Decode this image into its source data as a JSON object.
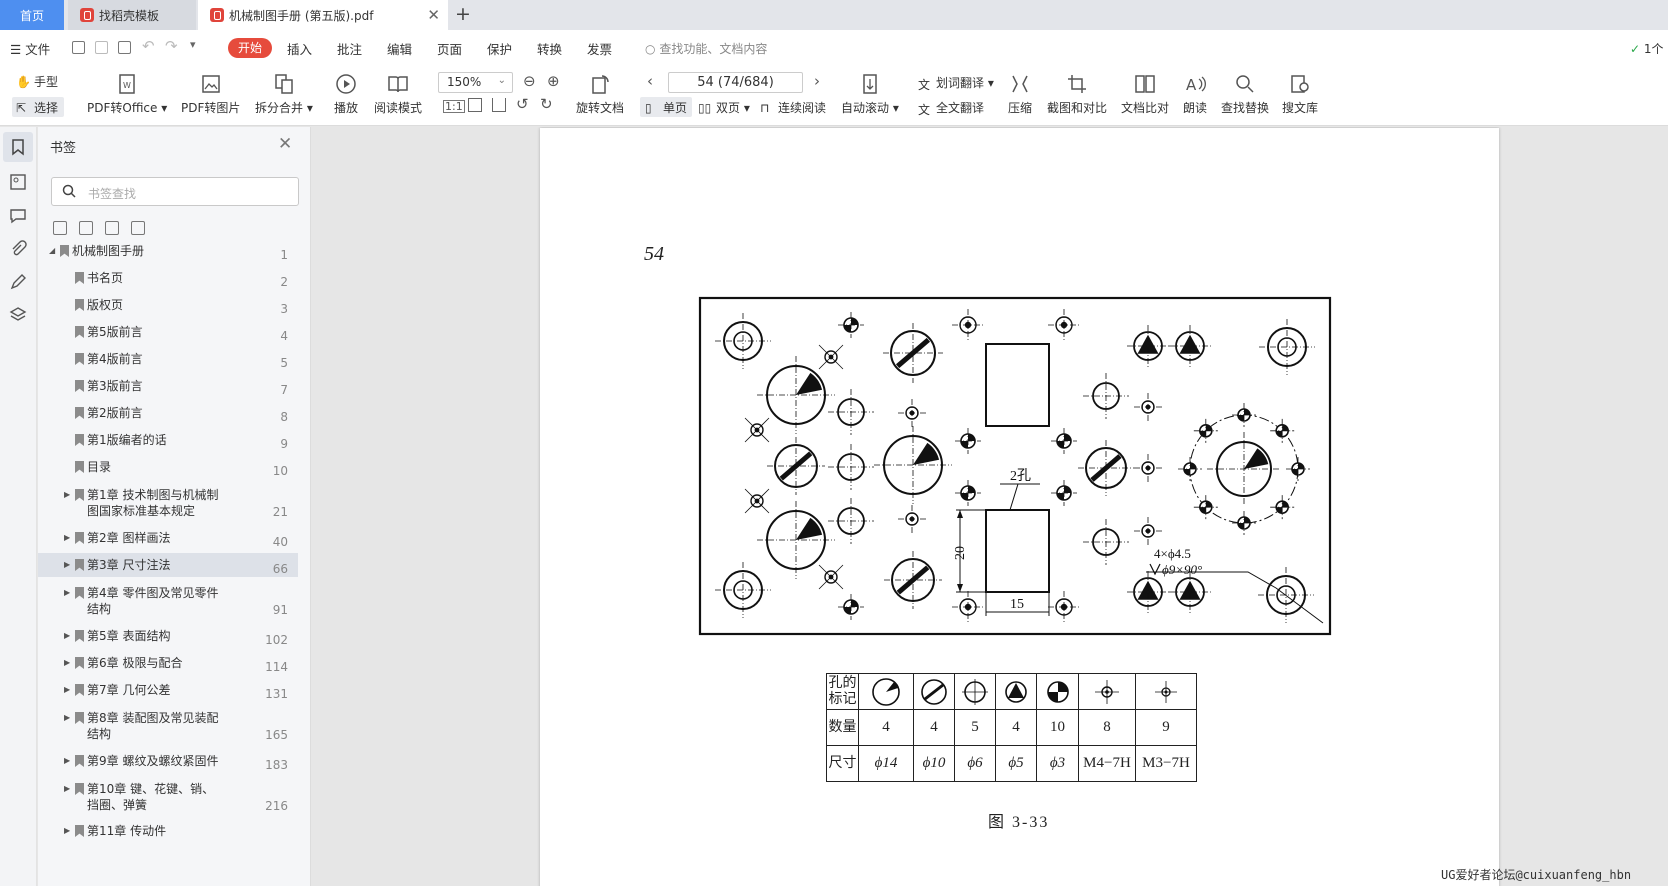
{
  "tabs": {
    "home": "首页",
    "template": "找稻壳模板",
    "doc": "机械制图手册 (第五版).pdf"
  },
  "menu": {
    "file": "文件",
    "start": "开始",
    "items": [
      "插入",
      "批注",
      "编辑",
      "页面",
      "保护",
      "转换",
      "发票"
    ],
    "search_placeholder": "查找功能、文档内容",
    "sync": "1个"
  },
  "toolbar": {
    "hand": "手型",
    "select": "选择",
    "pdf_to_office": "PDF转Office",
    "pdf_to_image": "PDF转图片",
    "split_merge": "拆分合并",
    "play": "播放",
    "read_mode": "阅读模式",
    "zoom": "150%",
    "rotate": "旋转文档",
    "page_indicator": "54 (74/684)",
    "single": "单页",
    "double": "双页",
    "continuous": "连续阅读",
    "auto_scroll": "自动滚动",
    "word_translate": "划词翻译",
    "full_translate": "全文翻译",
    "compress": "压缩",
    "screenshot_compare": "截图和对比",
    "doc_compare": "文档比对",
    "read_aloud": "朗读",
    "find_replace": "查找替换",
    "search_library": "搜文库"
  },
  "sidebar": {
    "title": "书签",
    "search_placeholder": "书签查找",
    "items": [
      {
        "label": "机械制图手册",
        "page": "1"
      },
      {
        "label": "书名页",
        "page": "2"
      },
      {
        "label": "版权页",
        "page": "3"
      },
      {
        "label": "第5版前言",
        "page": "4"
      },
      {
        "label": "第4版前言",
        "page": "5"
      },
      {
        "label": "第3版前言",
        "page": "7"
      },
      {
        "label": "第2版前言",
        "page": "8"
      },
      {
        "label": "第1版编者的话",
        "page": "9"
      },
      {
        "label": "目录",
        "page": "10"
      },
      {
        "label": "第1章  技术制图与机械制",
        "label2": "图国家标准基本规定",
        "page": "21"
      },
      {
        "label": "第2章  图样画法",
        "page": "40"
      },
      {
        "label": "第3章  尺寸注法",
        "page": "66"
      },
      {
        "label": "第4章  零件图及常见零件",
        "label2": "结构",
        "page": "91"
      },
      {
        "label": "第5章  表面结构",
        "page": "102"
      },
      {
        "label": "第6章  极限与配合",
        "page": "114"
      },
      {
        "label": "第7章  几何公差",
        "page": "131"
      },
      {
        "label": "第8章  装配图及常见装配",
        "label2": "结构",
        "page": "165"
      },
      {
        "label": "第9章  螺纹及螺纹紧固件",
        "page": "183"
      },
      {
        "label": "第10章  键、花键、销、",
        "label2": "挡圈、弹簧",
        "page": "216"
      },
      {
        "label": "第11章  传动件",
        "page": ""
      }
    ]
  },
  "document": {
    "page_number": "54",
    "drawing_labels": {
      "holes": "2孔",
      "dim_20": "20",
      "dim_15": "15",
      "callout1": "4×ϕ4.5",
      "callout2": "ϕ9×90°"
    },
    "table": {
      "row_headers": [
        "孔的\n标记",
        "数量",
        "尺寸"
      ],
      "quantities": [
        "4",
        "4",
        "5",
        "4",
        "10",
        "8",
        "9"
      ],
      "sizes": [
        "ϕ14",
        "ϕ10",
        "ϕ6",
        "ϕ5",
        "ϕ3",
        "M4−7H",
        "M3−7H"
      ]
    },
    "caption": "图   3-33"
  },
  "watermark": "UG爱好者论坛@cuixuanfeng_hbn"
}
